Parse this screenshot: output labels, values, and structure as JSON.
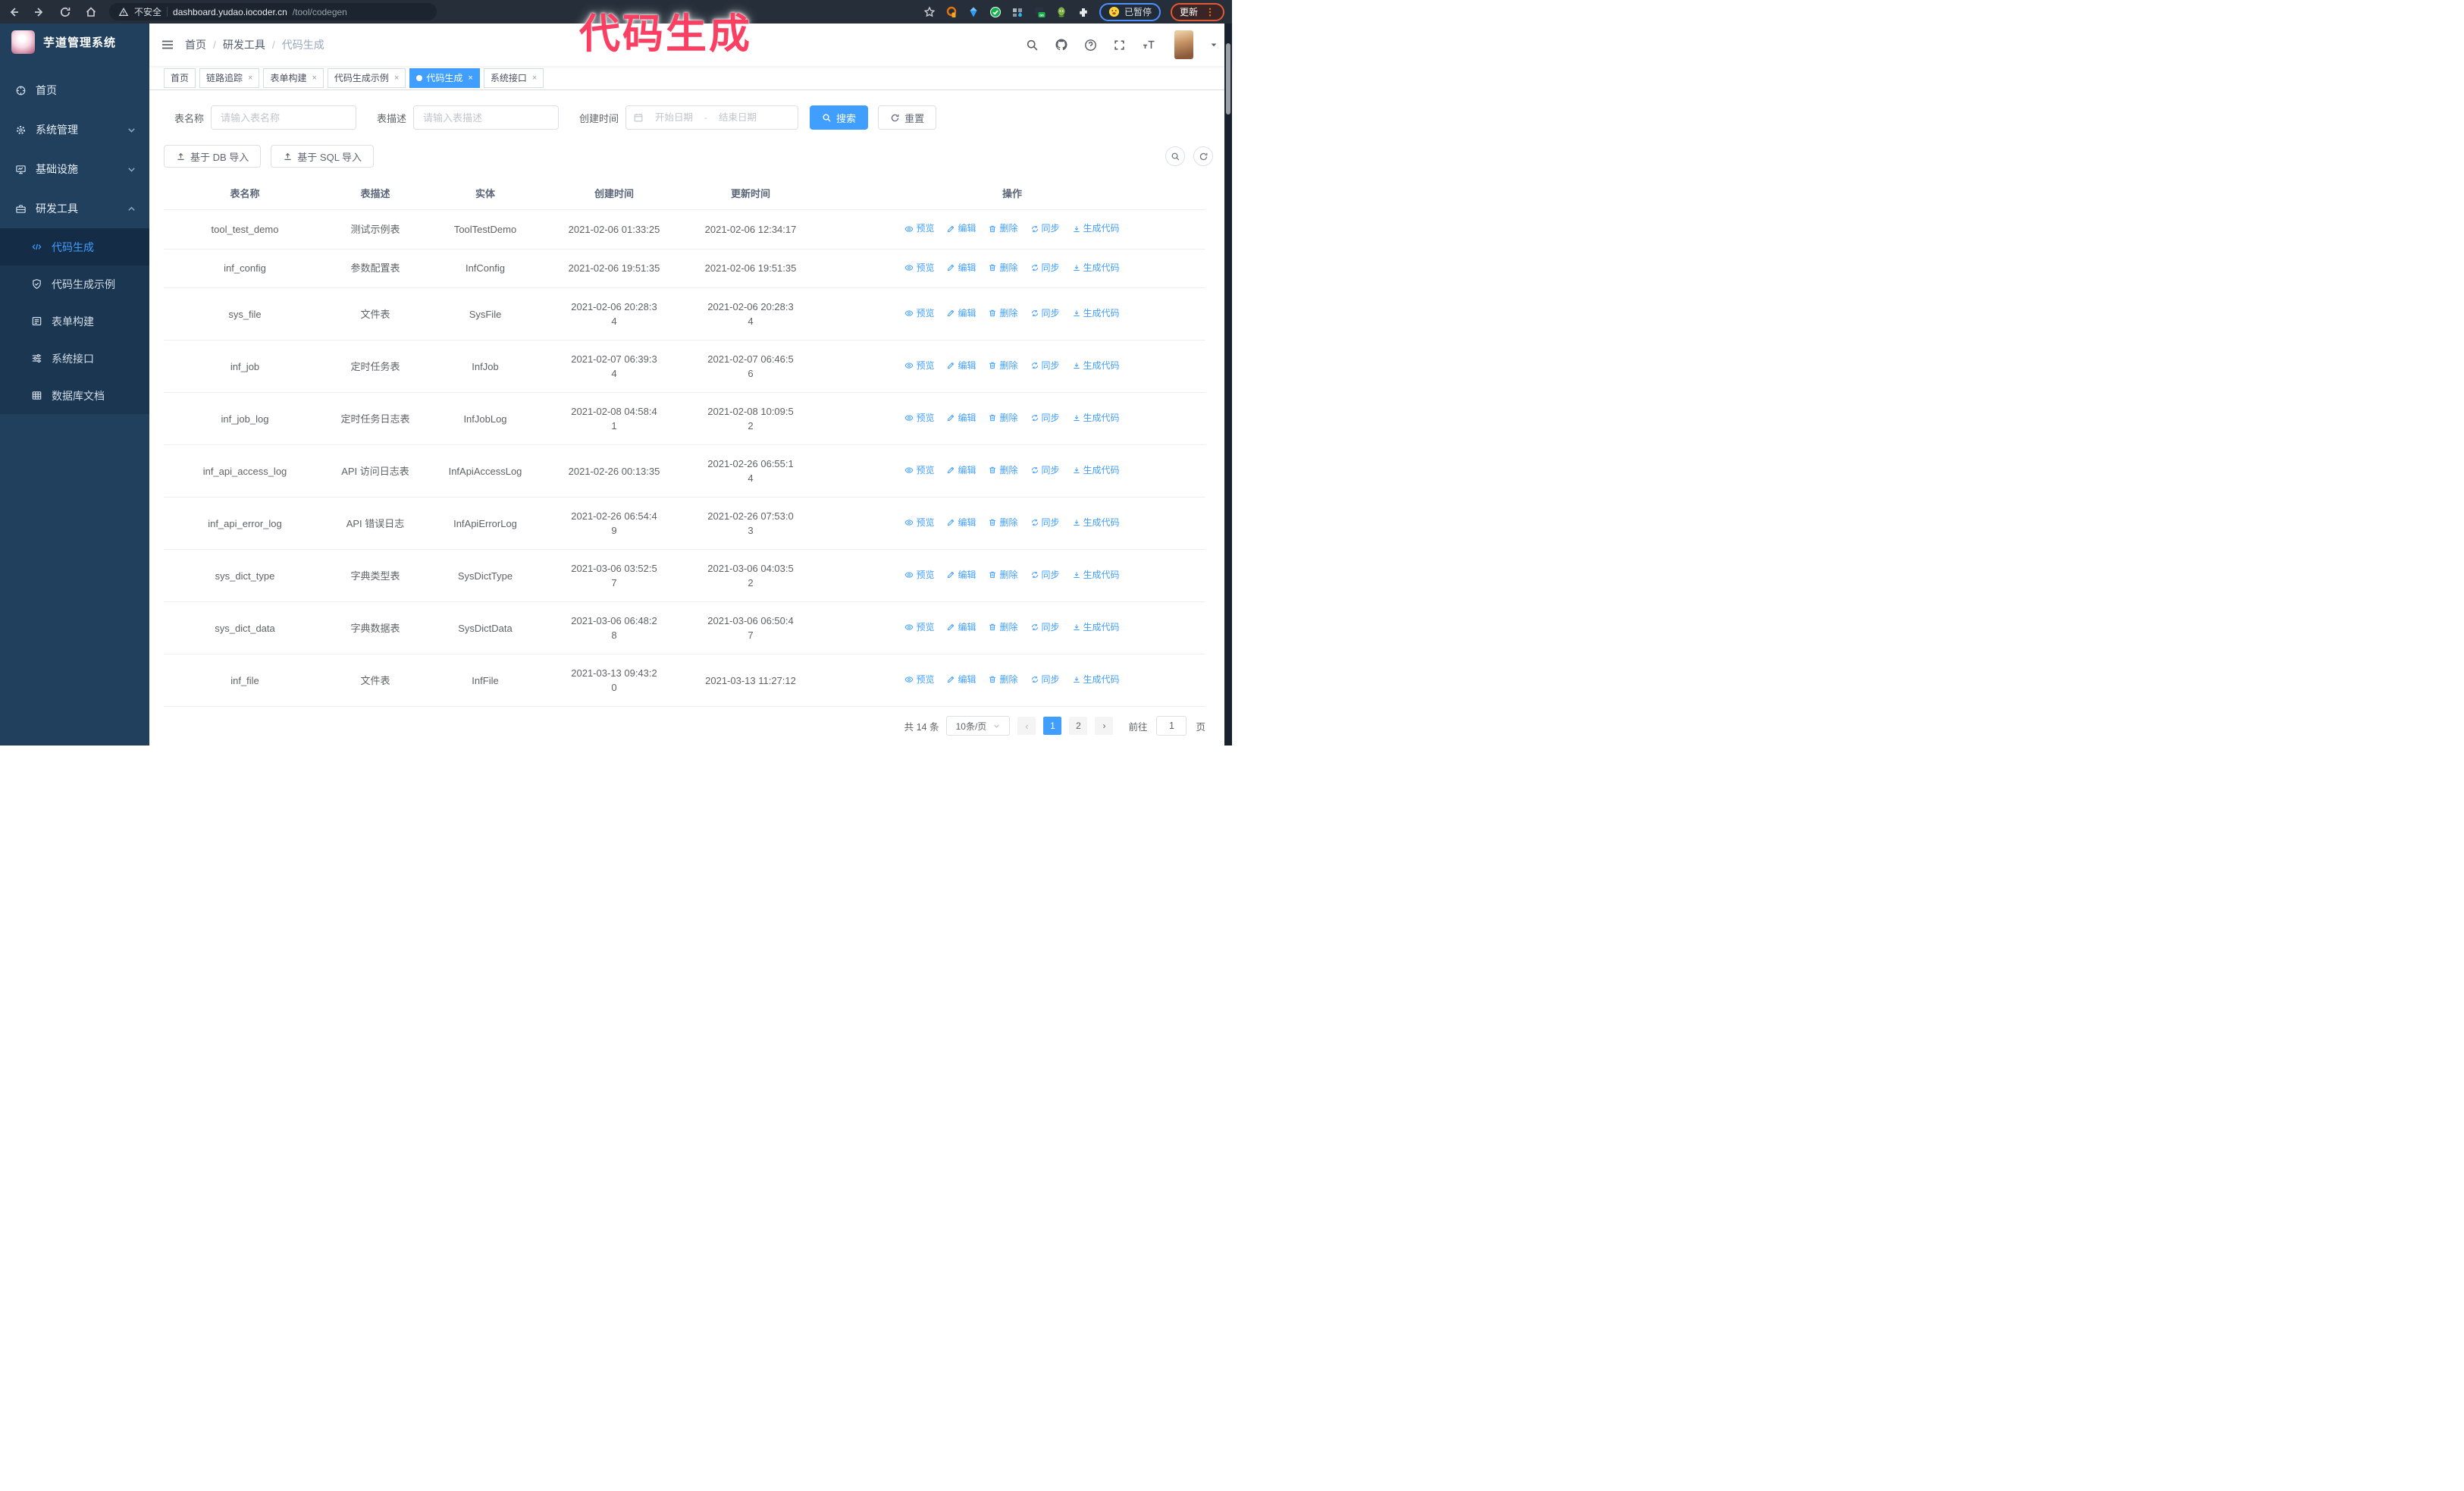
{
  "browser": {
    "not_secure": "不安全",
    "url_host": "dashboard.yudao.iocoder.cn",
    "url_path": "/tool/codegen",
    "profile_status": "已暂停",
    "update_button": "更新",
    "extension_badge": "on"
  },
  "overlay": {
    "text": "代码生成",
    "color": "#fb3f63"
  },
  "app": {
    "title": "芋道管理系统",
    "breadcrumb": [
      "首页",
      "研发工具",
      "代码生成"
    ]
  },
  "sidebar": {
    "menu": [
      {
        "icon": "dashboard",
        "label": "首页"
      },
      {
        "icon": "gear",
        "label": "系统管理",
        "chevron": "down"
      },
      {
        "icon": "infra",
        "label": "基础设施",
        "chevron": "down"
      },
      {
        "icon": "tools",
        "label": "研发工具",
        "chevron": "up",
        "children": [
          {
            "icon": "code",
            "label": "代码生成",
            "active": true
          },
          {
            "icon": "shield-check",
            "label": "代码生成示例"
          },
          {
            "icon": "form",
            "label": "表单构建"
          },
          {
            "icon": "sliders",
            "label": "系统接口"
          },
          {
            "icon": "db-doc",
            "label": "数据库文档"
          }
        ]
      }
    ]
  },
  "tabs": [
    {
      "label": "首页",
      "closable": false,
      "active": false
    },
    {
      "label": "链路追踪",
      "closable": true,
      "active": false
    },
    {
      "label": "表单构建",
      "closable": true,
      "active": false
    },
    {
      "label": "代码生成示例",
      "closable": true,
      "active": false
    },
    {
      "label": "代码生成",
      "closable": true,
      "active": true
    },
    {
      "label": "系统接口",
      "closable": true,
      "active": false
    }
  ],
  "filters": {
    "name_label": "表名称",
    "name_placeholder": "请输入表名称",
    "desc_label": "表描述",
    "desc_placeholder": "请输入表描述",
    "time_label": "创建时间",
    "date_start": "开始日期",
    "date_separator": "-",
    "date_end": "结束日期",
    "search_button": "搜索",
    "reset_button": "重置"
  },
  "toolbar": {
    "import_db": "基于 DB 导入",
    "import_sql": "基于 SQL 导入"
  },
  "table": {
    "columns": [
      "表名称",
      "表描述",
      "实体",
      "创建时间",
      "更新时间",
      "操作"
    ],
    "action_labels": [
      "预览",
      "编辑",
      "删除",
      "同步",
      "生成代码"
    ],
    "action_icons": [
      "eye",
      "edit",
      "delete",
      "sync",
      "download"
    ],
    "rows": [
      {
        "name": "tool_test_demo",
        "desc": "测试示例表",
        "entity": "ToolTestDemo",
        "create": "2021-02-06 01:33:25",
        "update": "2021-02-06 12:34:17"
      },
      {
        "name": "inf_config",
        "desc": "参数配置表",
        "entity": "InfConfig",
        "create": "2021-02-06 19:51:35",
        "update": "2021-02-06 19:51:35"
      },
      {
        "name": "sys_file",
        "desc": "文件表",
        "entity": "SysFile",
        "create": "2021-02-06 20:28:3\n4",
        "update": "2021-02-06 20:28:3\n4"
      },
      {
        "name": "inf_job",
        "desc": "定时任务表",
        "entity": "InfJob",
        "create": "2021-02-07 06:39:3\n4",
        "update": "2021-02-07 06:46:5\n6"
      },
      {
        "name": "inf_job_log",
        "desc": "定时任务日志表",
        "entity": "InfJobLog",
        "create": "2021-02-08 04:58:4\n1",
        "update": "2021-02-08 10:09:5\n2"
      },
      {
        "name": "inf_api_access_log",
        "desc": "API 访问日志表",
        "entity": "InfApiAccessLog",
        "create": "2021-02-26 00:13:35",
        "update": "2021-02-26 06:55:1\n4"
      },
      {
        "name": "inf_api_error_log",
        "desc": "API 错误日志",
        "entity": "InfApiErrorLog",
        "create": "2021-02-26 06:54:4\n9",
        "update": "2021-02-26 07:53:0\n3"
      },
      {
        "name": "sys_dict_type",
        "desc": "字典类型表",
        "entity": "SysDictType",
        "create": "2021-03-06 03:52:5\n7",
        "update": "2021-03-06 04:03:5\n2"
      },
      {
        "name": "sys_dict_data",
        "desc": "字典数据表",
        "entity": "SysDictData",
        "create": "2021-03-06 06:48:2\n8",
        "update": "2021-03-06 06:50:4\n7"
      },
      {
        "name": "inf_file",
        "desc": "文件表",
        "entity": "InfFile",
        "create": "2021-03-13 09:43:2\n0",
        "update": "2021-03-13 11:27:12"
      }
    ]
  },
  "pagination": {
    "total_text": "共 14 条",
    "page_size": "10条/页",
    "pages": [
      "1",
      "2"
    ],
    "active_page": "1",
    "goto_label": "前往",
    "goto_value": "1",
    "goto_suffix": "页"
  },
  "colors": {
    "accent": "#409eff",
    "sidebar_bg": "#20405e",
    "submenu_bg": "#1a3650",
    "overlay_pink": "#fb3f63"
  },
  "icons": {
    "browser": [
      "back",
      "forward",
      "reload",
      "home",
      "warning",
      "star",
      "extensions",
      "profile-face",
      "menu-dots"
    ],
    "header": [
      "hamburger",
      "search",
      "github",
      "help",
      "fullscreen",
      "font-size",
      "avatar",
      "caret-down"
    ],
    "actions": [
      "eye",
      "edit",
      "delete",
      "sync",
      "download"
    ],
    "misc": [
      "upload",
      "calendar",
      "magnifier",
      "refresh"
    ]
  }
}
